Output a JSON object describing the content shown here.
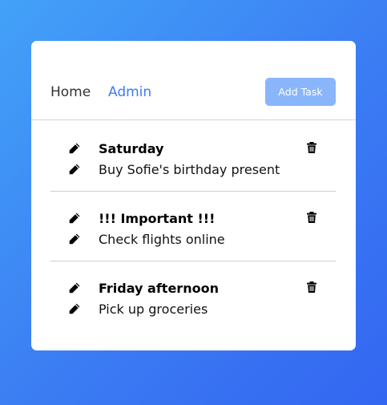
{
  "nav": {
    "home_label": "Home",
    "admin_label": "Admin"
  },
  "toolbar": {
    "add_task_label": "Add Task"
  },
  "tasks": [
    {
      "title": "Saturday",
      "description": "Buy Sofie's birthday present"
    },
    {
      "title": "!!! Important !!!",
      "description": "Check flights online"
    },
    {
      "title": "Friday afternoon",
      "description": "Pick up groceries"
    }
  ],
  "icons": {
    "edit": "pencil-icon",
    "delete": "trash-icon"
  },
  "colors": {
    "accent": "#3d7df0",
    "button": "#89b5fb",
    "background_start": "#43a2f8",
    "background_end": "#3366f2"
  }
}
